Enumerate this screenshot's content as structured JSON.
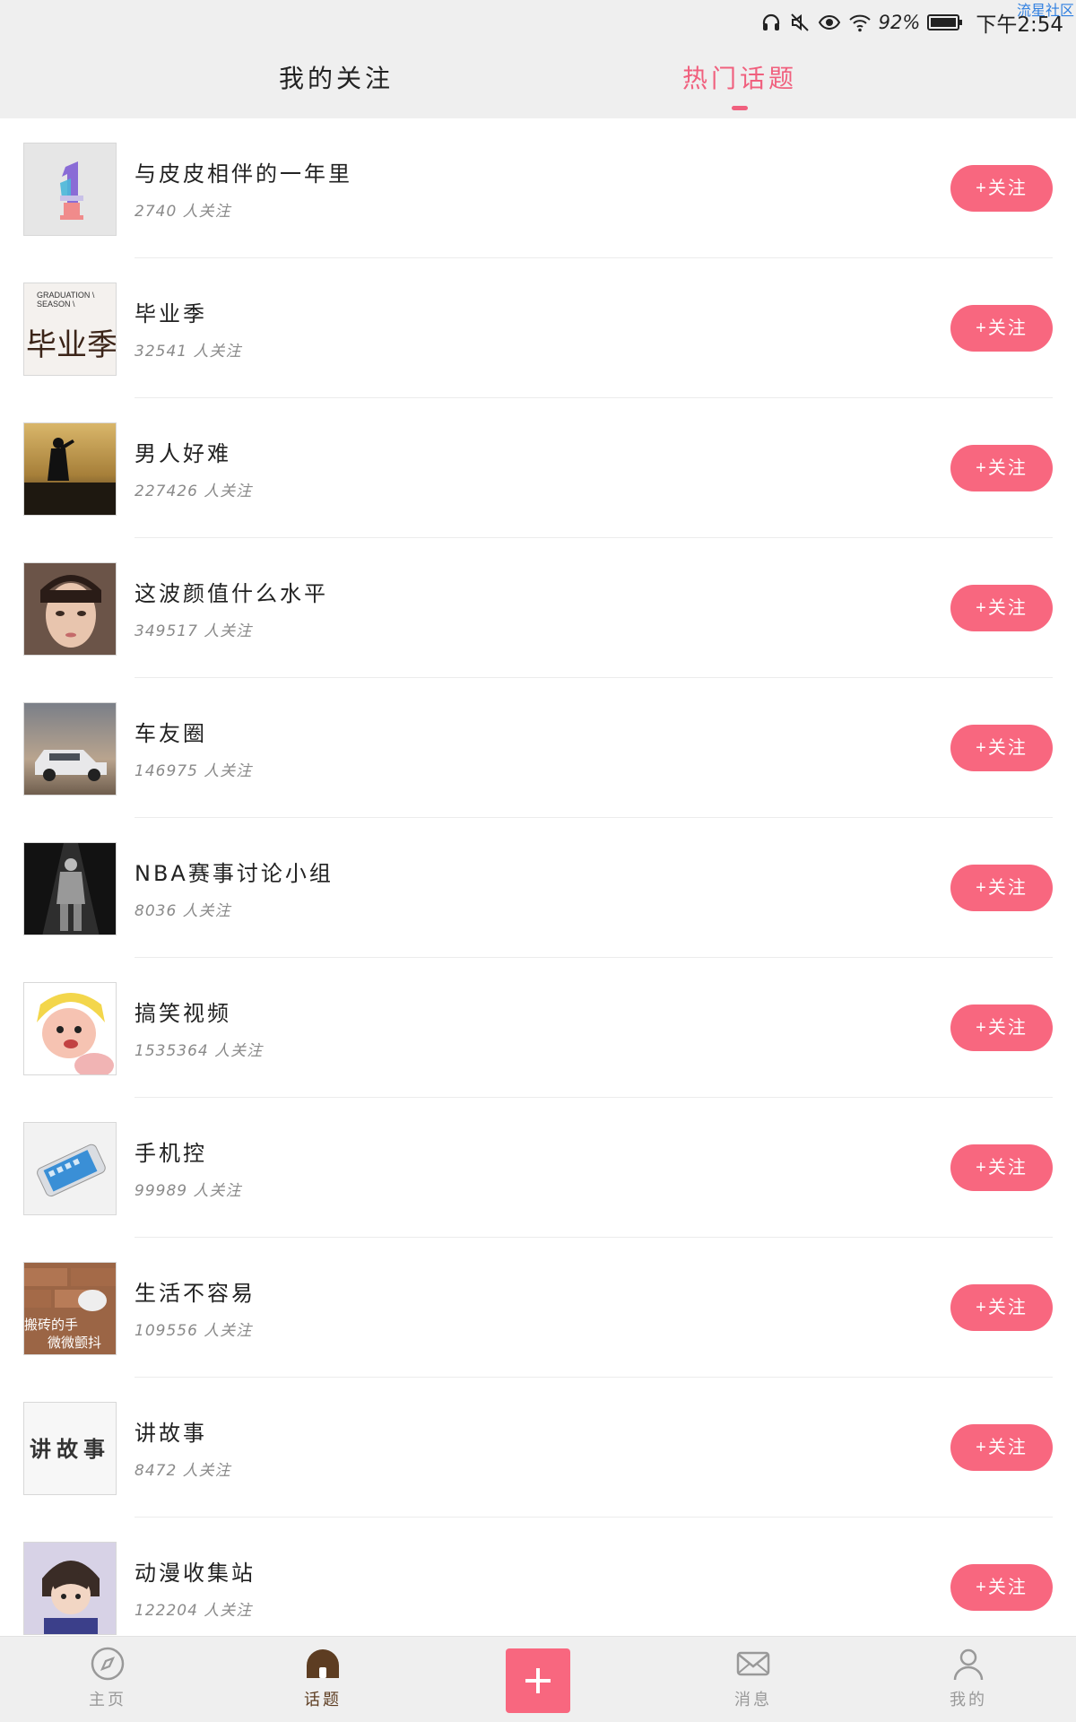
{
  "status_bar": {
    "battery": "92%",
    "time": "下午2:54",
    "watermark": "流星社区",
    "icons": [
      "headset-icon",
      "mute-icon",
      "eye-icon",
      "wifi-icon",
      "battery-icon"
    ]
  },
  "tabs": [
    {
      "label": "我的关注",
      "active": false
    },
    {
      "label": "热门话题",
      "active": true
    }
  ],
  "colors": {
    "accent": "#f8677f",
    "active_tab": "#f0607e",
    "nav_active": "#5d3d22"
  },
  "topics": [
    {
      "name": "与皮皮相伴的一年里",
      "followers": "2740 人关注",
      "button": "+关注",
      "thumb": "anniversary-1-image"
    },
    {
      "name": "毕业季",
      "followers": "32541 人关注",
      "button": "+关注",
      "thumb": "graduation-season-image"
    },
    {
      "name": "男人好难",
      "followers": "227426 人关注",
      "button": "+关注",
      "thumb": "silhouette-sunset-image"
    },
    {
      "name": "这波颜值什么水平",
      "followers": "349517 人关注",
      "button": "+关注",
      "thumb": "girl-portrait-image"
    },
    {
      "name": "车友圈",
      "followers": "146975 人关注",
      "button": "+关注",
      "thumb": "suv-car-image"
    },
    {
      "name": "NBA赛事讨论小组",
      "followers": "8036 人关注",
      "button": "+关注",
      "thumb": "basketball-player-image"
    },
    {
      "name": "搞笑视频",
      "followers": "1535364 人关注",
      "button": "+关注",
      "thumb": "cartoon-girl-image"
    },
    {
      "name": "手机控",
      "followers": "99989 人关注",
      "button": "+关注",
      "thumb": "smartphone-image"
    },
    {
      "name": "生活不容易",
      "followers": "109556 人关注",
      "button": "+关注",
      "thumb": "brick-hand-image",
      "thumb_caption_1": "搬砖的手",
      "thumb_caption_2": "微微颤抖"
    },
    {
      "name": "讲故事",
      "followers": "8472 人关注",
      "button": "+关注",
      "thumb": "storytelling-text-image",
      "thumb_text": "讲故事"
    },
    {
      "name": "动漫收集站",
      "followers": "122204 人关注",
      "button": "+关注",
      "thumb": "anime-character-image"
    }
  ],
  "thumb_texts": {
    "graduation_line1": "GRADUATION \\",
    "graduation_line2": "SEASON \\",
    "graduation_big": "毕业季"
  },
  "bottom_nav": [
    {
      "label": "主页",
      "icon": "compass-icon"
    },
    {
      "label": "话题",
      "icon": "topic-icon",
      "active": true
    },
    {
      "label": "",
      "icon": "plus-icon"
    },
    {
      "label": "消息",
      "icon": "mail-icon"
    },
    {
      "label": "我的",
      "icon": "user-icon"
    }
  ]
}
